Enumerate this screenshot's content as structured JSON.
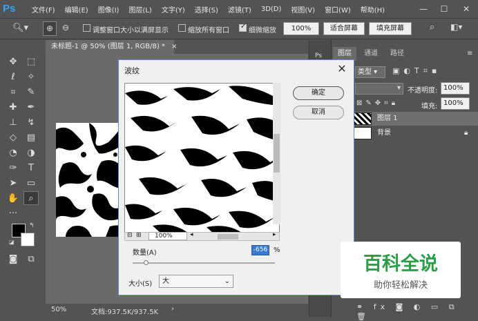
{
  "menubar": {
    "logo": "Ps",
    "items": [
      "文件(F)",
      "编辑(E)",
      "图像(I)",
      "图层(L)",
      "文字(Y)",
      "选择(S)",
      "滤镜(T)",
      "3D(D)",
      "视图(V)",
      "窗口(W)",
      "帮助(H)"
    ],
    "controls": [
      "—",
      "☐",
      "✕"
    ]
  },
  "options": {
    "resize_label": "调整窗口大小以满屏显示",
    "zoom_all_label": "缩放所有窗口",
    "scrubby_label": "细微缩放",
    "btn_100": "100%",
    "btn_fit": "适合屏幕",
    "btn_fill": "填充屏幕"
  },
  "document": {
    "tab_title": "未标题-1 @ 50% (图层 1, RGB/8) *",
    "tab_close": "×",
    "zoom": "50%",
    "doc_info": "文档:937.5K/937.5K"
  },
  "panel": {
    "tabs": [
      "图层",
      "通道",
      "路径"
    ],
    "kind_label": "类型",
    "opacity_label": "不透明度:",
    "opacity_value": "100%",
    "fill_label": "填充:",
    "fill_value": "100%",
    "layers": [
      {
        "name": "图层 1"
      },
      {
        "name": "背景"
      }
    ],
    "side_badge": "Ps"
  },
  "dialog": {
    "title": "波纹",
    "ok": "确定",
    "cancel": "取消",
    "zoom": "100%",
    "amount_label": "数量(A)",
    "amount_value": "-656",
    "amount_unit": "%",
    "amount_slider": 0.09,
    "size_label": "大小(S)",
    "size_value": "大"
  },
  "watermark": {
    "title": "百科全说",
    "subtitle": "助你轻松解决"
  },
  "colors": {
    "accent": "#2fa3f7",
    "watermark_green": "#2aa046",
    "dialog_bg": "#f0f0f0",
    "selection_blue": "#3a78d4"
  }
}
